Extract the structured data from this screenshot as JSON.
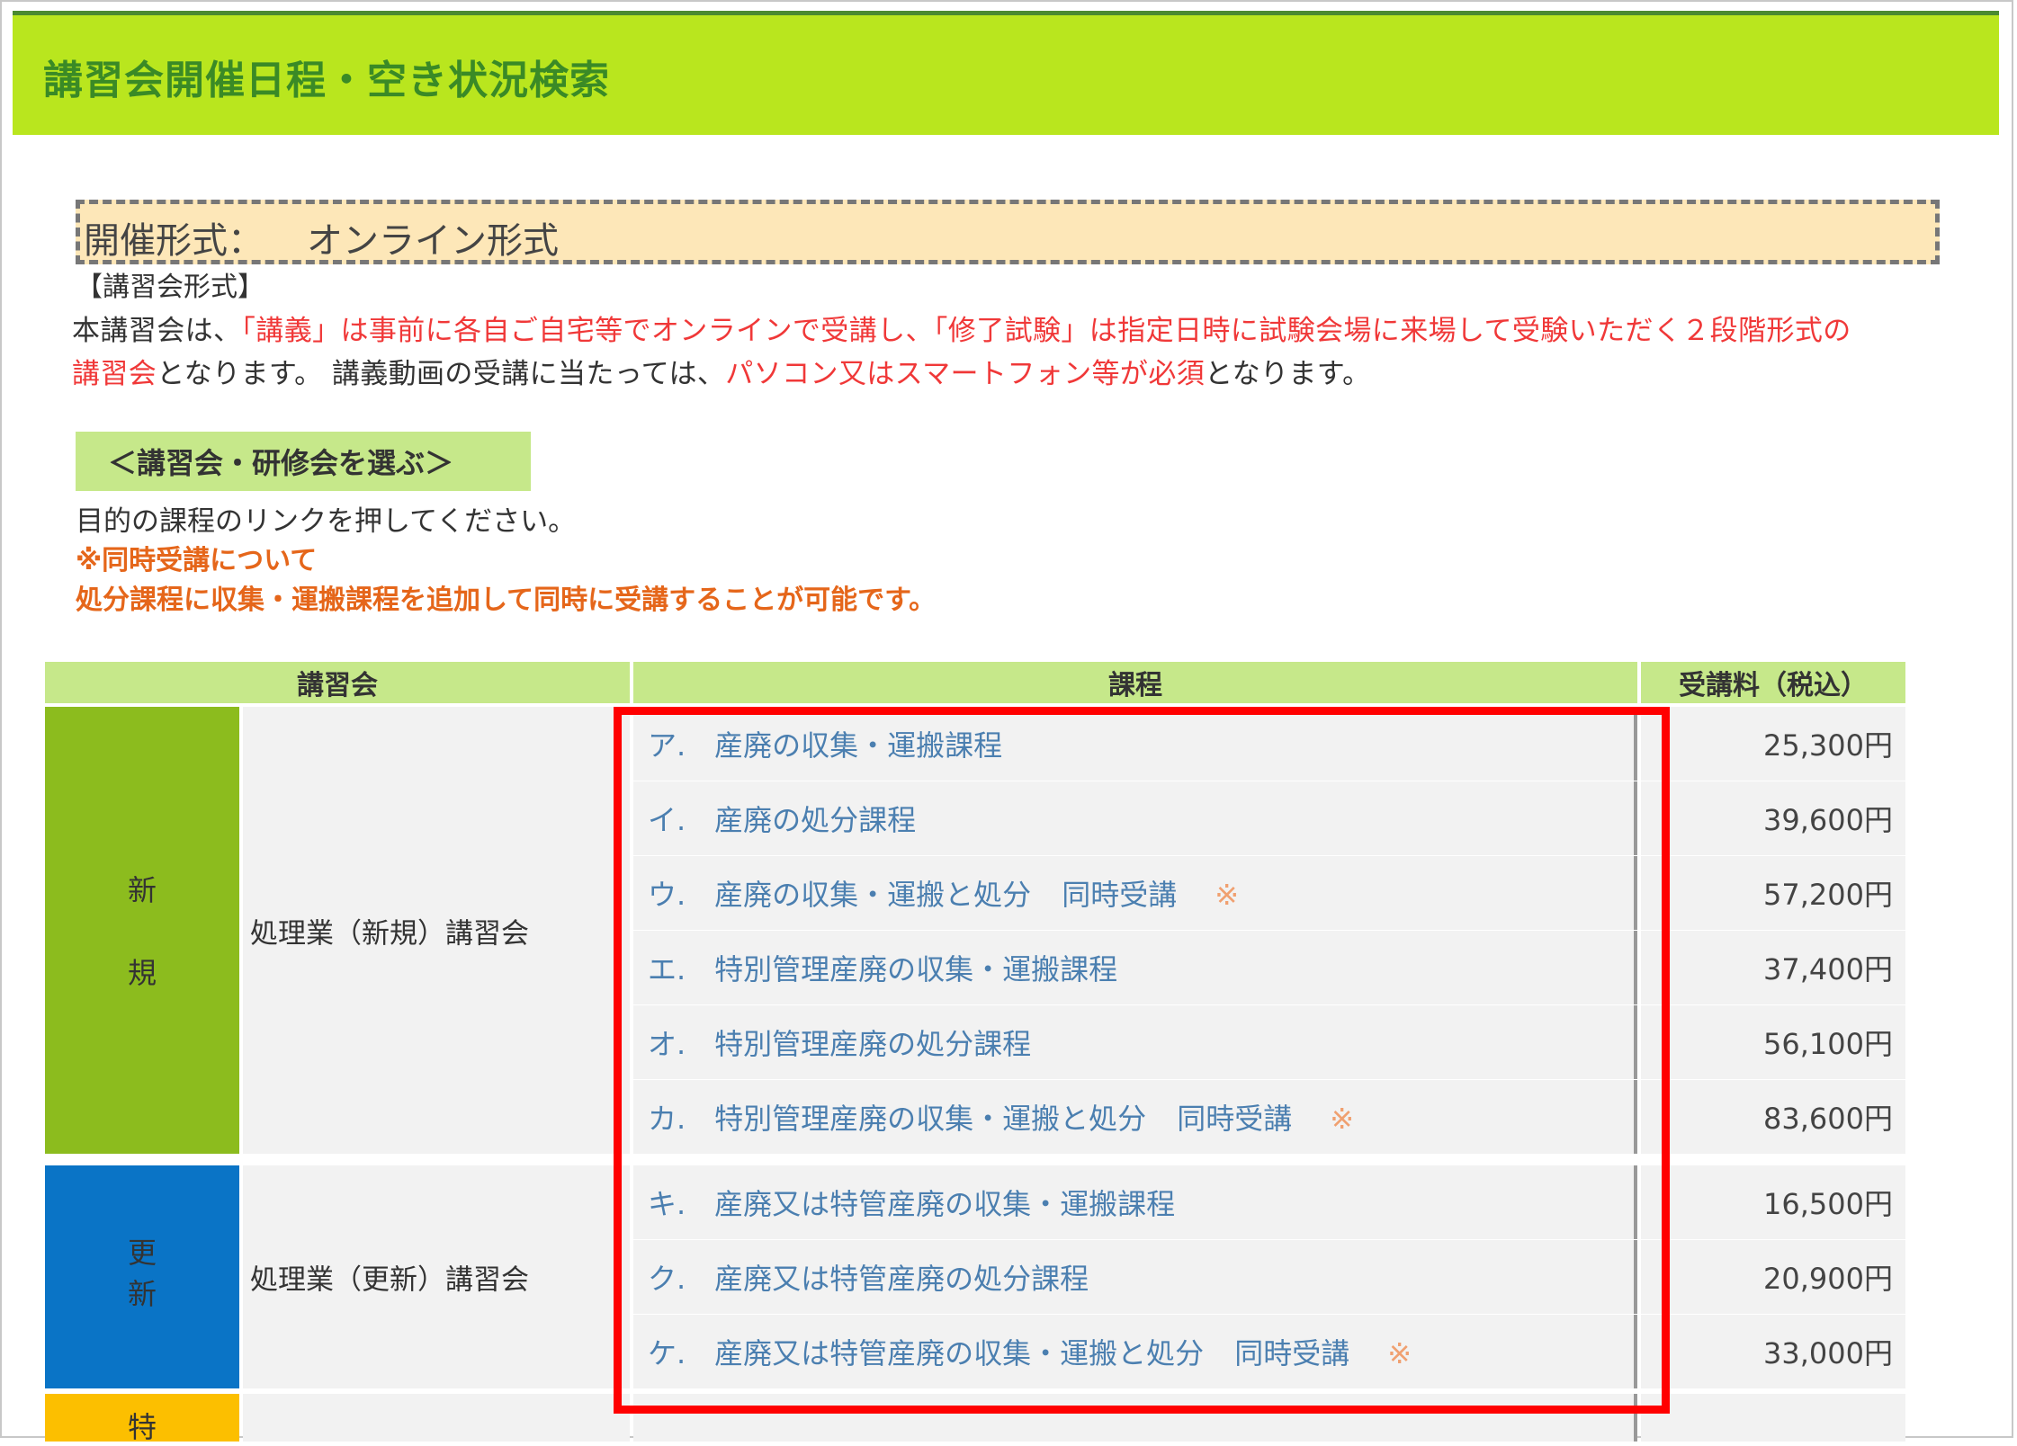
{
  "header": {
    "title": "講習会開催日程・空き状況検索"
  },
  "format": {
    "label": "開催形式：",
    "value": "オンライン形式"
  },
  "intro": {
    "heading": "【講習会形式】",
    "line1": [
      {
        "text": "本講習会は、",
        "red": false
      },
      {
        "text": "「講義」は事前に各自ご自宅等でオンラインで受講し、「修了試験」は指定日時に試験会場に来場して受験いただく２段階形式の",
        "red": true
      }
    ],
    "line2": [
      {
        "text": "講習会",
        "red": true
      },
      {
        "text": "となります。 講義動画の受講に当たっては、",
        "red": false
      },
      {
        "text": "パソコン又はスマートフォン等が必須",
        "red": true
      },
      {
        "text": "となります。",
        "red": false
      }
    ]
  },
  "select": {
    "heading": "＜講習会・研修会を選ぶ＞",
    "instruction": "目的の課程のリンクを押してください。",
    "note_title": "※同時受講について",
    "note_body": "処分課程に収集・運搬課程を追加して同時に受講することが可能です。"
  },
  "table": {
    "headers": {
      "course_group": "講習会",
      "course": "課程",
      "fee": "受講料（税込）"
    },
    "groups": [
      {
        "badge": [
          "新",
          "規"
        ],
        "name": "処理業（新規）講習会",
        "color": "#8cbc1e",
        "rows": [
          {
            "course": "ア.　産廃の収集・運搬課程",
            "tag": "",
            "mark": "",
            "fee": "25,300円"
          },
          {
            "course": "イ.　産廃の処分課程",
            "tag": "",
            "mark": "",
            "fee": "39,600円"
          },
          {
            "course": "ウ.　産廃の収集・運搬と処分",
            "tag": "同時受講",
            "mark": "※",
            "fee": "57,200円"
          },
          {
            "course": "エ.　特別管理産廃の収集・運搬課程",
            "tag": "",
            "mark": "",
            "fee": "37,400円"
          },
          {
            "course": "オ.　特別管理産廃の処分課程",
            "tag": "",
            "mark": "",
            "fee": "56,100円"
          },
          {
            "course": "カ.　特別管理産廃の収集・運搬と処分",
            "tag": "同時受講",
            "mark": "※",
            "fee": "83,600円"
          }
        ]
      },
      {
        "badge": [
          "更",
          "新"
        ],
        "name": "処理業（更新）講習会",
        "color": "#0a74c6",
        "rows": [
          {
            "course": "キ.　産廃又は特管産廃の収集・運搬課程",
            "tag": "",
            "mark": "",
            "fee": "16,500円"
          },
          {
            "course": "ク.　産廃又は特管産廃の処分課程",
            "tag": "",
            "mark": "",
            "fee": "20,900円"
          },
          {
            "course": "ケ.　産廃又は特管産廃の収集・運搬と処分",
            "tag": "同時受講",
            "mark": "※",
            "fee": "33,000円"
          }
        ]
      },
      {
        "badge": [
          "特"
        ],
        "name": "",
        "color": "#fcbf00",
        "rows": []
      }
    ]
  },
  "highlight": {
    "color": "#ff0000"
  }
}
